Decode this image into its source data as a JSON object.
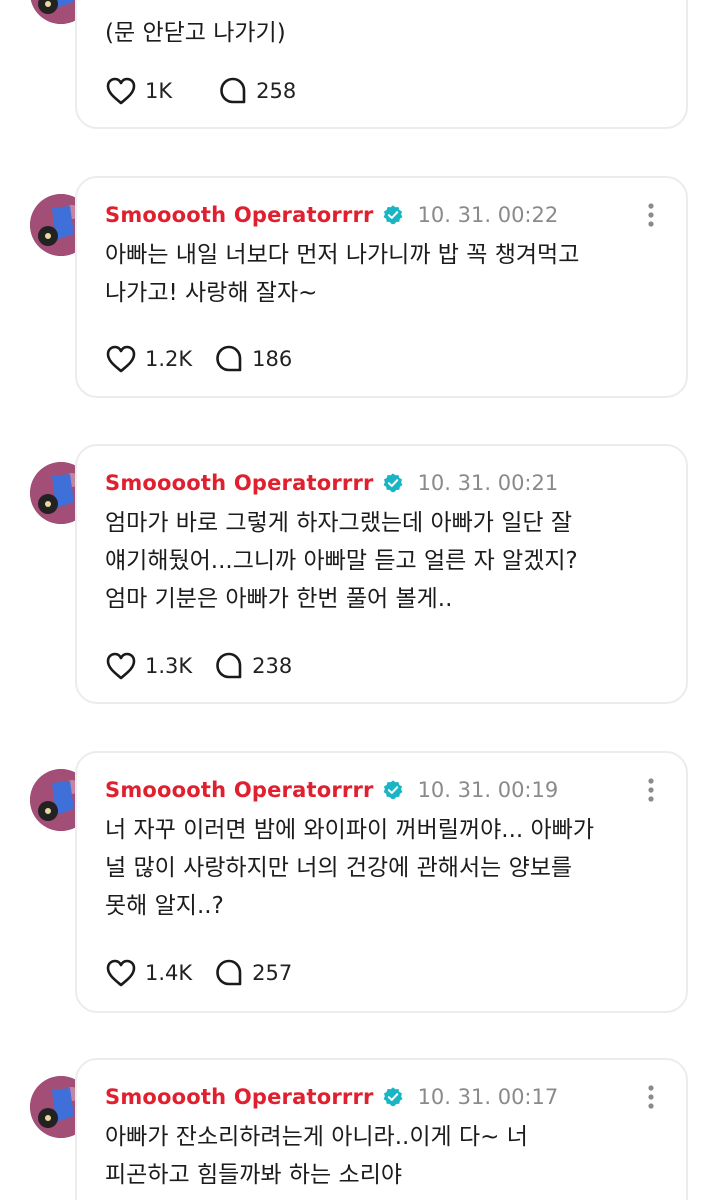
{
  "posts": [
    {
      "text": "(문 안닫고 나가기)",
      "likes": "1K",
      "comments": "258"
    },
    {
      "author": "Smooooth Operatorrrr",
      "time": "10. 31. 00:22",
      "text": "아빠는 내일 너보다 먼저 나가니까 밥 꼭 챙겨먹고\n나가고! 사랑해 잘자~",
      "likes": "1.2K",
      "comments": "186"
    },
    {
      "author": "Smooooth Operatorrrr",
      "time": "10. 31. 00:21",
      "text": "엄마가 바로 그렇게 하자그랬는데 아빠가 일단 잘\n얘기해뒀어...그니까 아빠말 듣고 얼른 자 알겠지?\n엄마 기분은 아빠가 한번 풀어 볼게..",
      "likes": "1.3K",
      "comments": "238"
    },
    {
      "author": "Smooooth Operatorrrr",
      "time": "10. 31. 00:19",
      "text": "너 자꾸 이러면 밤에 와이파이 꺼버릴꺼야... 아빠가\n널 많이 사랑하지만 너의 건강에 관해서는 양보를\n못해 알지..?",
      "likes": "1.4K",
      "comments": "257"
    },
    {
      "author": "Smooooth Operatorrrr",
      "time": "10. 31. 00:17",
      "text": "아빠가 잔소리하려는게 아니라..이게 다~ 너\n피곤하고 힘들까봐 하는 소리야"
    }
  ],
  "icons": {
    "like": "heart-icon",
    "comment": "speech-bubble-icon",
    "verified": "verified-badge-icon",
    "more": "more-vertical-icon"
  },
  "colors": {
    "author": "#e0202e",
    "verified": "#1ab5c4",
    "timestamp": "#8a8a8a",
    "card_border": "#ececec"
  }
}
